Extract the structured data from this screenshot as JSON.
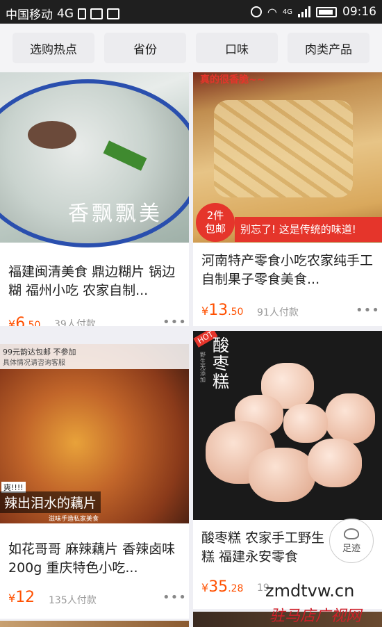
{
  "status_bar": {
    "carrier": "中国移动",
    "network": "4G",
    "network_small": "4G",
    "time": "09:16"
  },
  "filters": [
    "选购热点",
    "省份",
    "口味",
    "肉类产品"
  ],
  "products": [
    {
      "title": "福建闽清美食 鼎边糊片 锅边糊 福州小吃 农家自制...",
      "currency": "¥",
      "price_int": "6",
      "price_dec": ".50",
      "sold": "39人付款",
      "image_text": "香飘飘美"
    },
    {
      "title": "河南特产零食小吃农家纯手工自制果子零食美食...",
      "currency": "¥",
      "price_int": "13",
      "price_dec": ".50",
      "sold": "91人付款",
      "badge_line1": "2件",
      "badge_line2": "包邮",
      "banner": "别忘了! 这是传统的味道!",
      "top_banner": "真的很香脆~~"
    },
    {
      "title": "如花哥哥 麻辣藕片 香辣卤味 200g 重庆特色小吃...",
      "currency": "¥",
      "price_int": "12",
      "price_dec": "",
      "sold": "135人付款",
      "promo_line1": "99元韵达包邮 不参加",
      "promo_line2": "具体情况请咨询客服",
      "image_tag": "爽!!!!",
      "image_caption": "辣出泪水的藕片",
      "image_sub": "滋味手造私家美食"
    },
    {
      "title": "酸枣糕 农家手工野生 糕 福建永安零食",
      "currency": "¥",
      "price_int": "35",
      "price_dec": ".28",
      "sold": "19",
      "hot_tag": "HOT",
      "image_title": "酸枣糕",
      "image_side": "野生无添加"
    }
  ],
  "floating_button": {
    "label": "足迹"
  },
  "watermark": {
    "url": "zmdtvw.cn",
    "name": "驻马店广视网"
  },
  "colors": {
    "price": "#ff5000",
    "badge": "#e5352b",
    "status_bar": "#1f1f1f"
  }
}
